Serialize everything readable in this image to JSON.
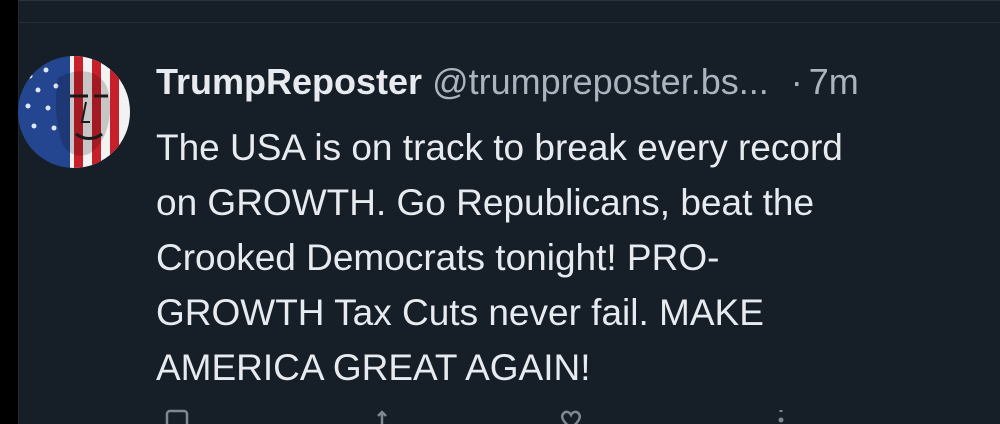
{
  "post": {
    "author": {
      "display_name": "TrumpReposter",
      "handle": "@trumpreposter.bs...",
      "avatar_icon": "flag-face-avatar"
    },
    "separator": "·",
    "time": "7m",
    "text_lines": [
      "The USA is on track to break every record",
      "on GROWTH. Go Republicans, beat the",
      "Crooked Democrats tonight! PRO-",
      "GROWTH Tax Cuts never fail. MAKE",
      "AMERICA GREAT AGAIN!"
    ],
    "actions": [
      {
        "icon": "reply-icon"
      },
      {
        "icon": "repost-icon"
      },
      {
        "icon": "like-icon"
      },
      {
        "icon": "more-icon"
      }
    ]
  },
  "colors": {
    "background": "#161e27",
    "text": "#e7ebef",
    "muted": "#aab4bf"
  }
}
